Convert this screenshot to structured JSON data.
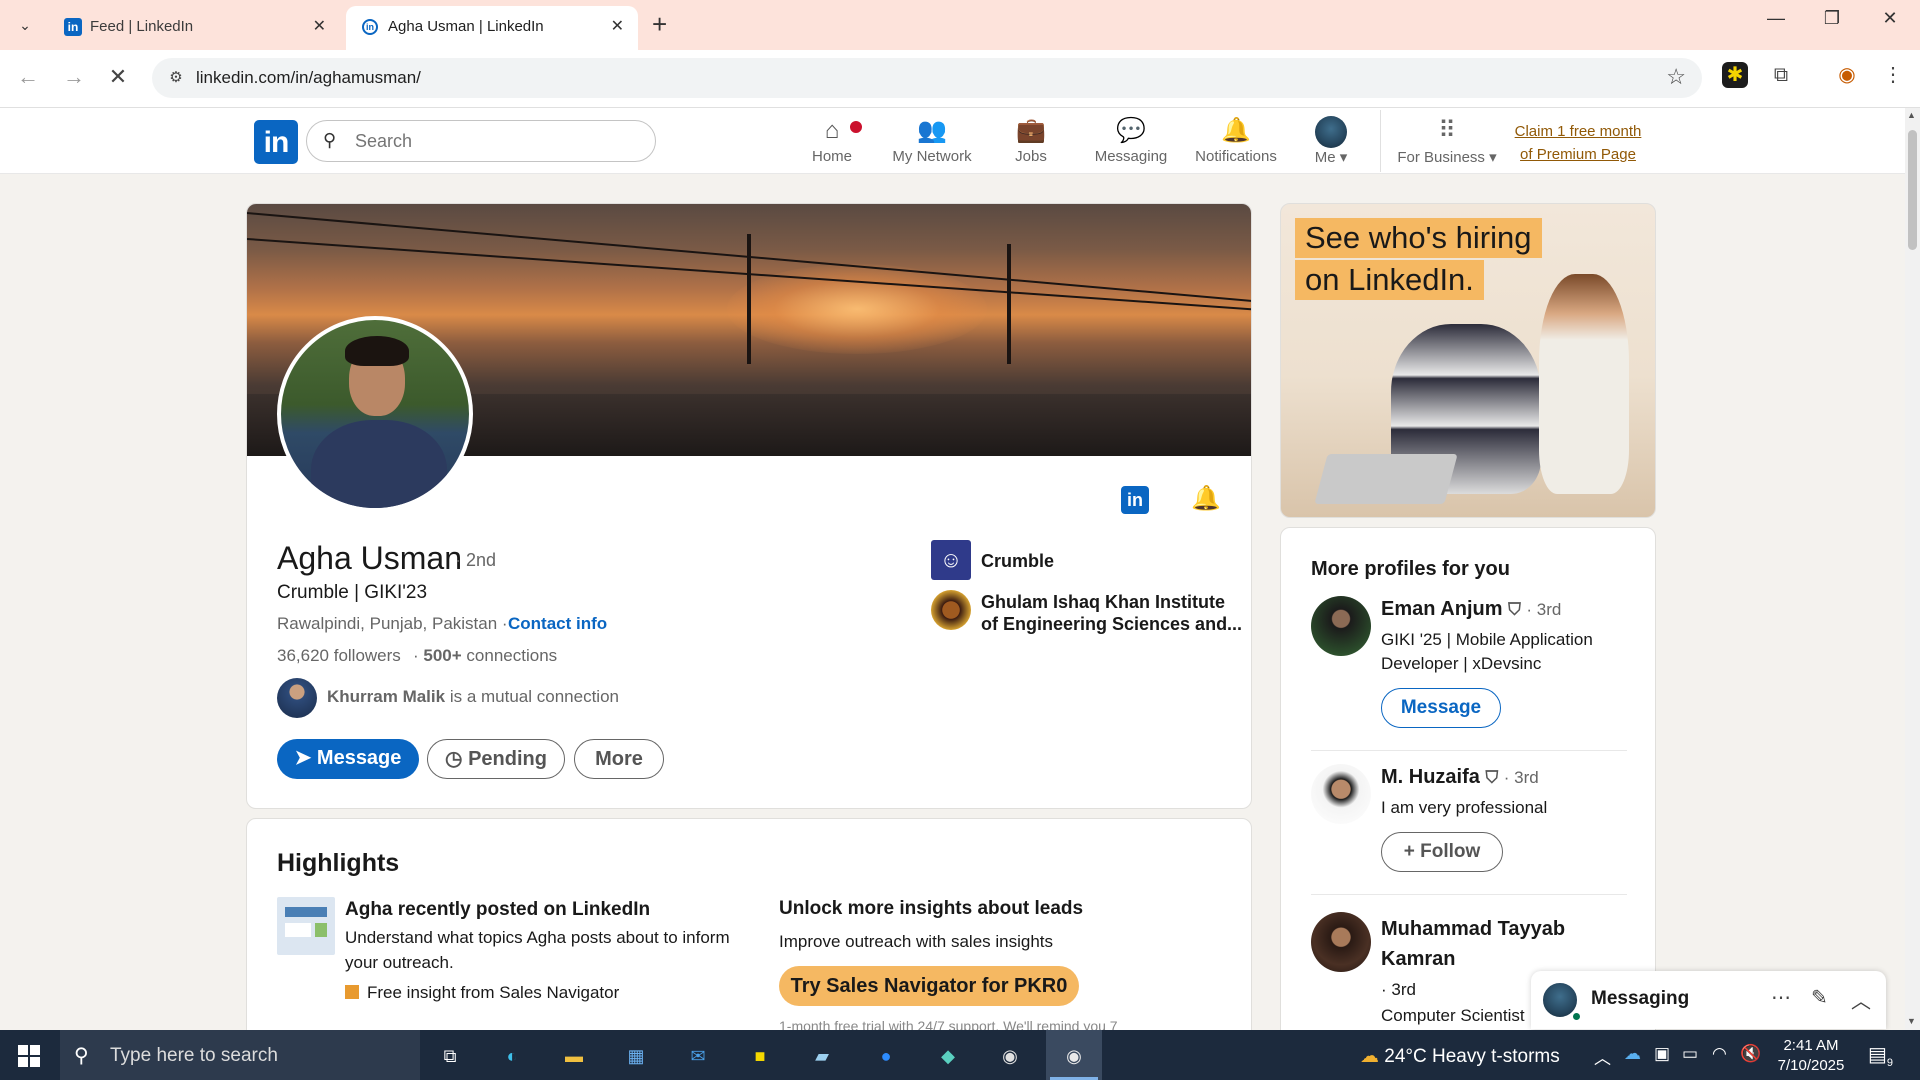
{
  "browser": {
    "tabs": [
      {
        "title": "Feed | LinkedIn",
        "active": false
      },
      {
        "title": "Agha Usman | LinkedIn",
        "active": true
      }
    ],
    "url": "linkedin.com/in/aghamusman/"
  },
  "header": {
    "search_placeholder": "Search",
    "nav": [
      {
        "label": "Home",
        "icon": "home-icon"
      },
      {
        "label": "My Network",
        "icon": "network-icon"
      },
      {
        "label": "Jobs",
        "icon": "briefcase-icon"
      },
      {
        "label": "Messaging",
        "icon": "chat-icon"
      },
      {
        "label": "Notifications",
        "icon": "bell-icon"
      },
      {
        "label": "Me",
        "icon": "avatar"
      },
      {
        "label": "For Business",
        "icon": "grid-icon"
      }
    ],
    "premium_line1": "Claim 1 free month",
    "premium_line2": "of Premium Page"
  },
  "profile": {
    "name": "Agha Usman",
    "degree": "· 2nd",
    "headline": "Crumble | GIKI'23",
    "location": "Rawalpindi, Punjab, Pakistan ·",
    "contact_info": "Contact info",
    "followers": "36,620 followers",
    "connections_count": "500+",
    "connections_label": "connections",
    "mutual_name": "Khurram Malik",
    "mutual_suffix": "is a mutual connection",
    "buttons": {
      "message": "Message",
      "pending": "Pending",
      "more": "More"
    },
    "company": "Crumble",
    "education_line1": "Ghulam Ishaq Khan Institute",
    "education_line2": "of Engineering Sciences and..."
  },
  "highlights": {
    "title": "Highlights",
    "left_heading": "Agha recently posted on LinkedIn",
    "left_desc": "Understand what topics Agha posts about to inform your outreach.",
    "left_note": "Free insight from Sales Navigator",
    "right_heading": "Unlock more insights about leads",
    "right_desc": "Improve outreach with sales insights",
    "right_button": "Try Sales Navigator for PKR0",
    "right_foot": "1-month free trial with 24/7 support. We'll remind you 7"
  },
  "ad": {
    "line1": "See who's hiring",
    "line2": "on LinkedIn."
  },
  "more_profiles": {
    "title": "More profiles for you",
    "items": [
      {
        "name": "Eman Anjum",
        "degree": "· 3rd",
        "desc": "GIKI '25 | Mobile Application Developer | xDevsinc",
        "button": "Message"
      },
      {
        "name": "M. Huzaifa",
        "degree": "· 3rd",
        "desc": "I am very professional",
        "button": "Follow"
      },
      {
        "name_line1": "Muhammad Tayyab",
        "name_line2": "Kamran",
        "degree": "· 3rd",
        "desc": "Computer Scientist"
      }
    ]
  },
  "messaging": {
    "label": "Messaging"
  },
  "taskbar": {
    "search_placeholder": "Type here to search",
    "weather": "24°C  Heavy t-storms",
    "time": "2:41 AM",
    "date": "7/10/2025",
    "notifications_count": "9"
  },
  "colors": {
    "linkedin_blue": "#0a66c2",
    "premium_gold": "#f5b862",
    "tab_bar": "#fde3db"
  }
}
